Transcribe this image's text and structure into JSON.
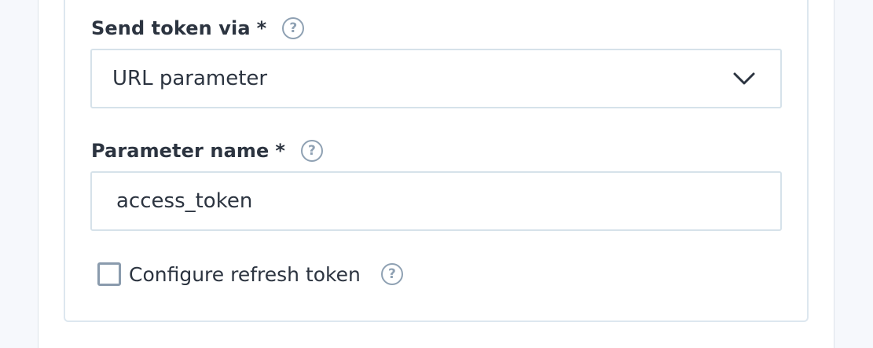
{
  "send_token": {
    "label": "Send token via",
    "required_marker": "*",
    "help_glyph": "?",
    "selected_value": "URL parameter",
    "chevron_icon": "chevron-down-icon"
  },
  "parameter_name": {
    "label": "Parameter name",
    "required_marker": "*",
    "help_glyph": "?",
    "value": "access_token"
  },
  "refresh_token": {
    "label": "Configure refresh token",
    "checked": false,
    "help_glyph": "?"
  },
  "colors": {
    "page_bg": "#f6f8fc",
    "text": "#2c3440",
    "border": "#d6e2ea",
    "help_icon": "#8fa1b3"
  }
}
